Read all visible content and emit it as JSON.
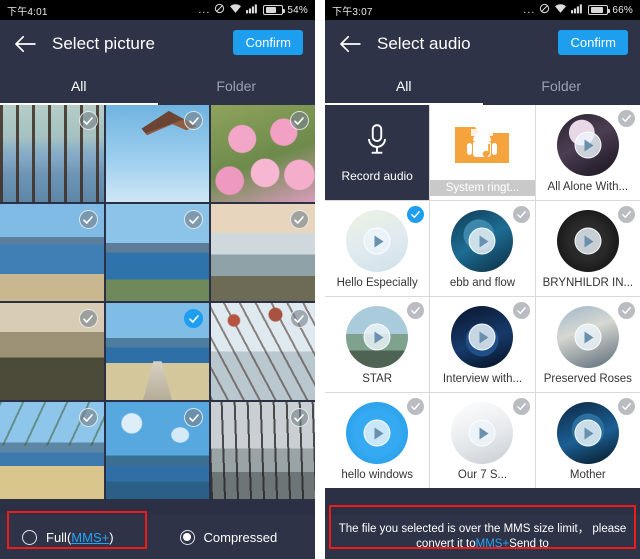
{
  "left_phone": {
    "status_bar": {
      "time": "下午4:01",
      "dots": "...",
      "battery_percent": "54%",
      "icons": [
        "dnd-icon",
        "wifi-icon",
        "signal-icon",
        "battery-icon"
      ]
    },
    "appbar": {
      "back": "back-arrow-icon",
      "title": "Select picture",
      "confirm_label": "Confirm"
    },
    "tabs": [
      {
        "label": "All",
        "active": true
      },
      {
        "label": "Folder",
        "active": false
      }
    ],
    "grid": [
      {
        "name": "lake-trees",
        "art": "ph-trees",
        "selected": false
      },
      {
        "name": "pagoda",
        "art": "ph-pagoda",
        "selected": false
      },
      {
        "name": "pink-flowers",
        "art": "ph-flowers",
        "selected": false
      },
      {
        "name": "lake-peninsula",
        "art": "ph-lake1",
        "selected": false
      },
      {
        "name": "lake-island",
        "art": "ph-lake2",
        "selected": false
      },
      {
        "name": "lake-shore",
        "art": "ph-lake3",
        "selected": false
      },
      {
        "name": "dusk-field",
        "art": "ph-dusk",
        "selected": false
      },
      {
        "name": "wooden-pier",
        "art": "ph-bridge",
        "selected": true
      },
      {
        "name": "blossom-branch",
        "art": "ph-blossom",
        "selected": false
      },
      {
        "name": "lake-grass",
        "art": "ph-lake4",
        "selected": false
      },
      {
        "name": "seagull",
        "art": "ph-bird",
        "selected": false
      },
      {
        "name": "reeds-sun",
        "art": "ph-reeds",
        "selected": false
      }
    ],
    "bottom_options": [
      {
        "name": "full-mms-option",
        "label_prefix": "Full(",
        "link": "MMS+",
        "label_suffix": ")",
        "selected": false,
        "highlighted": true
      },
      {
        "name": "compressed-option",
        "label_prefix": "Compressed",
        "link": "",
        "label_suffix": "",
        "selected": true,
        "highlighted": false
      }
    ]
  },
  "right_phone": {
    "status_bar": {
      "time": "下午3:07",
      "dots": "...",
      "battery_percent": "66%",
      "icons": [
        "dnd-icon",
        "wifi-icon",
        "signal-icon",
        "battery-icon"
      ]
    },
    "appbar": {
      "back": "back-arrow-icon",
      "title": "Select audio",
      "confirm_label": "Confirm"
    },
    "tabs": [
      {
        "label": "All",
        "active": true
      },
      {
        "label": "Folder",
        "active": false
      }
    ],
    "grid": [
      {
        "name": "record-audio",
        "label": "Record audio",
        "kind": "record",
        "art": "",
        "selected": null
      },
      {
        "name": "system-ringtone",
        "label": "System ringt...",
        "kind": "folder",
        "art": "",
        "selected": null
      },
      {
        "name": "all-alone-with",
        "label": "All Alone With...",
        "kind": "track",
        "art": "ar-allalone",
        "selected": false
      },
      {
        "name": "hello-especially",
        "label": "Hello Especially",
        "kind": "track",
        "art": "ar-hello",
        "selected": true
      },
      {
        "name": "ebb-and-flow",
        "label": "ebb and flow",
        "kind": "track",
        "art": "ar-ebb",
        "selected": false
      },
      {
        "name": "brynhildr",
        "label": "BRYNHILDR IN...",
        "kind": "track",
        "art": "ar-bryn",
        "selected": false
      },
      {
        "name": "star",
        "label": "STAR",
        "kind": "track",
        "art": "ar-star",
        "selected": false
      },
      {
        "name": "interview-with",
        "label": "Interview with...",
        "kind": "track",
        "art": "ar-intv",
        "selected": false
      },
      {
        "name": "preserved-roses",
        "label": "Preserved Roses",
        "kind": "track",
        "art": "ar-roses",
        "selected": false
      },
      {
        "name": "hello-windows",
        "label": "hello windows",
        "kind": "track",
        "art": "ar-hellow",
        "selected": false
      },
      {
        "name": "our-7-s",
        "label": "Our 7 S...",
        "kind": "track",
        "art": "ar-our7",
        "selected": false
      },
      {
        "name": "mother",
        "label": "Mother",
        "kind": "track",
        "art": "ar-mother",
        "selected": false
      }
    ],
    "toast": {
      "line1": "The file you selected is over the MMS size limit，  please",
      "line2_prefix": "convert it to",
      "line2_link": "MMS+",
      "line2_suffix": "Send to",
      "highlighted": true
    }
  },
  "colors": {
    "accent_blue": "#1e9eef",
    "link_blue": "#29a3f5",
    "chrome_dark": "#2e3348",
    "highlight_red": "#ee1b1b",
    "status_black": "#000000"
  }
}
